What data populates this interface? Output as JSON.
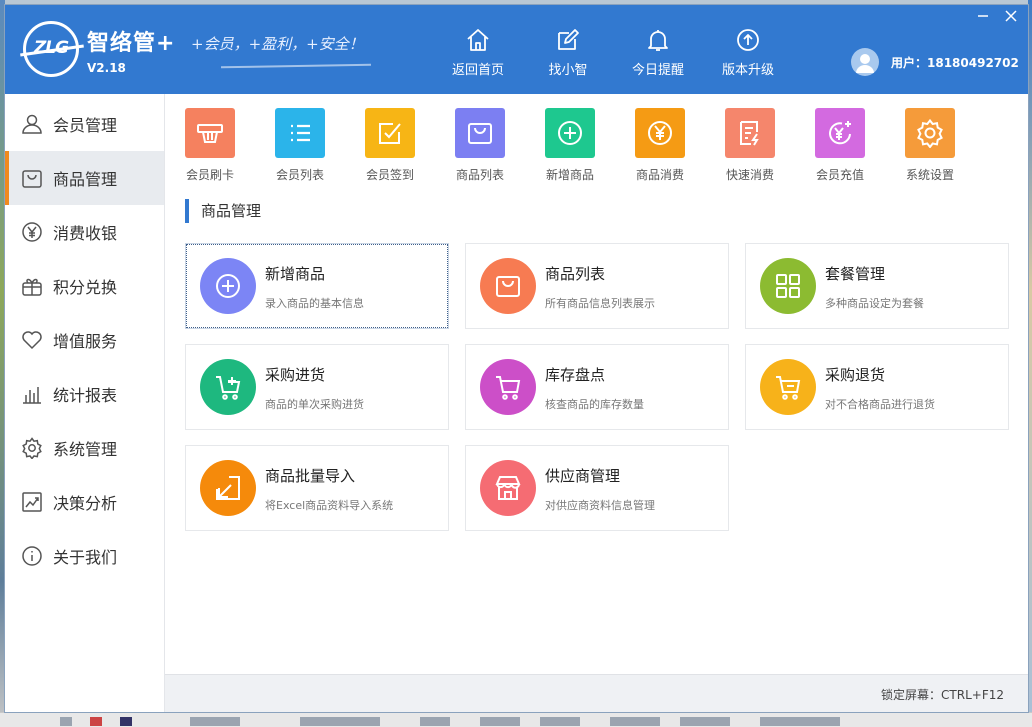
{
  "app": {
    "name": "智络管+",
    "slogan": "+会员，+盈利，+安全！",
    "version": "V2.18"
  },
  "top_nav": [
    {
      "label": "返回首页",
      "icon": "home-icon"
    },
    {
      "label": "找小智",
      "icon": "edit-icon"
    },
    {
      "label": "今日提醒",
      "icon": "bell-icon"
    },
    {
      "label": "版本升级",
      "icon": "upgrade-icon"
    }
  ],
  "user": {
    "label": "用户：18180492702"
  },
  "sidebar": {
    "active_index": 1,
    "items": [
      {
        "label": "会员管理",
        "icon": "user-icon"
      },
      {
        "label": "商品管理",
        "icon": "bag-icon"
      },
      {
        "label": "消费收银",
        "icon": "yen-icon"
      },
      {
        "label": "积分兑换",
        "icon": "gift-icon"
      },
      {
        "label": "增值服务",
        "icon": "heart-icon"
      },
      {
        "label": "统计报表",
        "icon": "bar-chart-icon"
      },
      {
        "label": "系统管理",
        "icon": "gear-icon"
      },
      {
        "label": "决策分析",
        "icon": "trend-icon"
      },
      {
        "label": "关于我们",
        "icon": "info-icon"
      }
    ]
  },
  "quick_actions": [
    {
      "label": "会员刷卡",
      "icon": "card-swipe-icon",
      "color": "#f5815f"
    },
    {
      "label": "会员列表",
      "icon": "list-icon",
      "color": "#2bb4ea"
    },
    {
      "label": "会员签到",
      "icon": "checkin-icon",
      "color": "#f7b515"
    },
    {
      "label": "商品列表",
      "icon": "bag-icon",
      "color": "#7c7ff2"
    },
    {
      "label": "新增商品",
      "icon": "plus-circle-icon",
      "color": "#1ec88f"
    },
    {
      "label": "商品消费",
      "icon": "yen-circle-icon",
      "color": "#f59b14"
    },
    {
      "label": "快速消费",
      "icon": "receipt-icon",
      "color": "#f5866c"
    },
    {
      "label": "会员充值",
      "icon": "recharge-icon",
      "color": "#d36ae0"
    },
    {
      "label": "系统设置",
      "icon": "gear-icon",
      "color": "#f59b3a"
    }
  ],
  "section": {
    "title": "商品管理"
  },
  "cards": [
    {
      "title": "新增商品",
      "desc": "录入商品的基本信息",
      "icon": "plus-circle-icon",
      "color": "#7c85f5"
    },
    {
      "title": "商品列表",
      "desc": "所有商品信息列表展示",
      "icon": "bag-icon",
      "color": "#f77b52"
    },
    {
      "title": "套餐管理",
      "desc": "多种商品设定为套餐",
      "icon": "grid-icon",
      "color": "#8cbb31"
    },
    {
      "title": "采购进货",
      "desc": "商品的单次采购进货",
      "icon": "cart-plus-icon",
      "color": "#1eb87f"
    },
    {
      "title": "库存盘点",
      "desc": "核查商品的库存数量",
      "icon": "cart-icon",
      "color": "#cc4fc8"
    },
    {
      "title": "采购退货",
      "desc": "对不合格商品进行退货",
      "icon": "cart-return-icon",
      "color": "#f7b21a"
    },
    {
      "title": "商品批量导入",
      "desc": "将Excel商品资料导入系统",
      "icon": "import-icon",
      "color": "#f58a0b"
    },
    {
      "title": "供应商管理",
      "desc": "对供应商资料信息管理",
      "icon": "shop-icon",
      "color": "#f56c73"
    }
  ],
  "status": {
    "lock_hint": "锁定屏幕：CTRL+F12"
  }
}
